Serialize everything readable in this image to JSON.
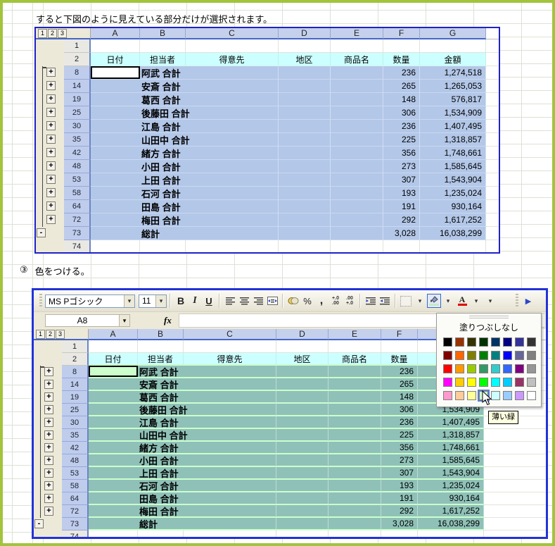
{
  "page": {
    "caption": "すると下図のように見えている部分だけが選択されます。",
    "step_marker": "③",
    "step_text": "色をつける。"
  },
  "colors": {
    "page_border_green": "#A2C43C",
    "screenshot_border_blue": "#2233D6",
    "selection_blue": "#B3C7E8",
    "selection_teal": "#8FC1B8",
    "light_green_fill": "#CCFFCC",
    "header_cyan": "#CCFFFF",
    "toolbar_beige": "#ECE9D8"
  },
  "glyphs": {
    "expand": "+",
    "collapse": "-",
    "dropdown": "▾",
    "play": "▶",
    "dot": "●"
  },
  "outline_levels": [
    "1",
    "2",
    "3"
  ],
  "columns": [
    "A",
    "B",
    "C",
    "D",
    "E",
    "F",
    "G"
  ],
  "empty_row_top": "1",
  "empty_row_bottom": "74",
  "header_row": {
    "num": "2",
    "labels": [
      "日付",
      "担当者",
      "得意先",
      "地区",
      "商品名",
      "数量",
      "金額"
    ]
  },
  "rows": [
    {
      "row": "8",
      "name": "阿武 合計",
      "qty": "236",
      "amount": "1,274,518"
    },
    {
      "row": "14",
      "name": "安斎 合計",
      "qty": "265",
      "amount": "1,265,053"
    },
    {
      "row": "19",
      "name": "葛西 合計",
      "qty": "148",
      "amount": "576,817"
    },
    {
      "row": "25",
      "name": "後藤田 合計",
      "qty": "306",
      "amount": "1,534,909"
    },
    {
      "row": "30",
      "name": "江島 合計",
      "qty": "236",
      "amount": "1,407,495"
    },
    {
      "row": "35",
      "name": "山田中 合計",
      "qty": "225",
      "amount": "1,318,857"
    },
    {
      "row": "42",
      "name": "緒方 合計",
      "qty": "356",
      "amount": "1,748,661"
    },
    {
      "row": "48",
      "name": "小田 合計",
      "qty": "273",
      "amount": "1,585,645"
    },
    {
      "row": "53",
      "name": "上田 合計",
      "qty": "307",
      "amount": "1,543,904"
    },
    {
      "row": "58",
      "name": "石河 合計",
      "qty": "193",
      "amount": "1,235,024"
    },
    {
      "row": "64",
      "name": "田島 合計",
      "qty": "191",
      "amount": "930,164"
    },
    {
      "row": "72",
      "name": "梅田 合計",
      "qty": "292",
      "amount": "1,617,252"
    },
    {
      "row": "73",
      "name": "総計",
      "qty": "3,028",
      "amount": "16,038,299"
    }
  ],
  "active_cell": {
    "ref": "A8",
    "row": "8",
    "col": "A"
  },
  "toolbar": {
    "font_name": "MS Pゴシック",
    "font_size": "11",
    "bold_label": "B",
    "italic_label": "I",
    "underline_label": "U",
    "percent_label": "%",
    "comma_label": ",",
    "inc_decimal_top": "+.0",
    "inc_decimal_bottom": ".00",
    "dec_decimal_top": ".00",
    "dec_decimal_bottom": "+.0",
    "font_color_label": "A",
    "fx_label": "fx",
    "name_box": "A8"
  },
  "fill_palette": {
    "no_fill_label": "塗りつぶしなし",
    "tooltip": "薄い緑",
    "selected_index": 35,
    "selected_color": "#CCFFCC",
    "colors": [
      "#000000",
      "#993300",
      "#333300",
      "#003300",
      "#003366",
      "#000080",
      "#333399",
      "#333333",
      "#800000",
      "#FF6600",
      "#808000",
      "#008000",
      "#008080",
      "#0000FF",
      "#666699",
      "#808080",
      "#FF0000",
      "#FF9900",
      "#99CC00",
      "#339966",
      "#33CCCC",
      "#3366FF",
      "#800080",
      "#969696",
      "#FF00FF",
      "#FFCC00",
      "#FFFF00",
      "#00FF00",
      "#00FFFF",
      "#00CCFF",
      "#993366",
      "#C0C0C0",
      "#FF99CC",
      "#FFCC99",
      "#FFFF99",
      "#CCFFCC",
      "#CCFFFF",
      "#99CCFF",
      "#CC99FF",
      "#FFFFFF"
    ]
  }
}
